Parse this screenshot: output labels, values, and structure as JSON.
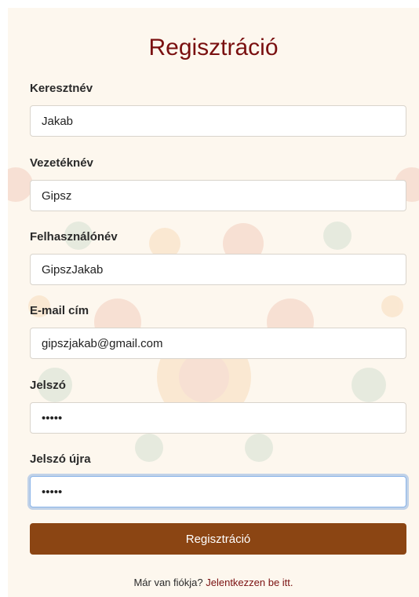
{
  "title": "Regisztráció",
  "fields": [
    {
      "label": "Keresztnév",
      "value": "Jakab",
      "type": "text"
    },
    {
      "label": "Vezetéknév",
      "value": "Gipsz",
      "type": "text"
    },
    {
      "label": "Felhasználónév",
      "value": "GipszJakab",
      "type": "text"
    },
    {
      "label": "E-mail cím",
      "value": "gipszjakab@gmail.com",
      "type": "email"
    },
    {
      "label": "Jelszó",
      "value": "•••••",
      "type": "password"
    },
    {
      "label": "Jelszó újra",
      "value": "•••••",
      "type": "password"
    }
  ],
  "submit_label": "Regisztráció",
  "footer": {
    "prompt": "Már van fiókja?",
    "link": "Jelentkezzen be itt."
  },
  "colors": {
    "title": "#7a1010",
    "button": "#8b4513",
    "card_bg": "#fdf7ee",
    "focus_ring": "#8ab4e8"
  }
}
